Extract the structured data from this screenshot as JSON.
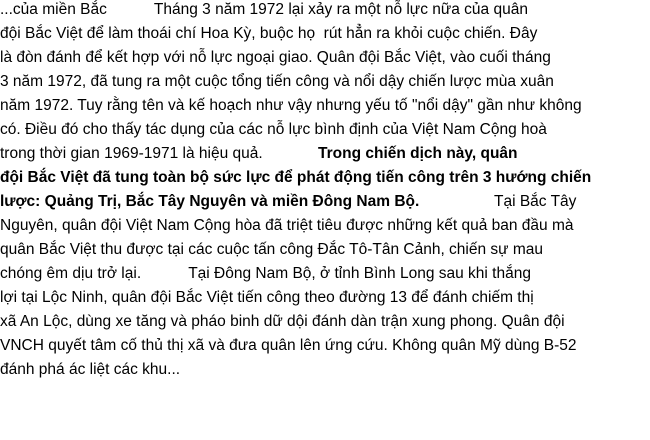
{
  "document": {
    "lines": [
      "...của miền Bắc           Tháng 3 năm 1972 lại xảy ra một nỗ lực nữa của quân",
      "đội Bắc Việt để làm thoái chí Hoa Kỳ, buộc họ  rút hẳn ra khỏi cuộc chiến. Đây",
      "là đòn đánh để kết hợp với nỗ lực ngoại giao. Quân đội Bắc Việt, vào cuối tháng",
      "3 năm 1972, đã tung ra một cuộc tổng tiến công và nổi dậy chiến lược mùa xuân",
      "năm 1972. Tuy rằng tên và kế hoạch như vậy nhưng yếu tố \"nổi dậy\" gần như không",
      "có. Điều đó cho thấy tác dụng của các nỗ lực bình định của Việt Nam Cộng hoà",
      "trong thời gian 1969-1971 là hiệu quả.",
      "Trong chiến dịch này, quân",
      "đội Bắc Việt đã tung toàn bộ sức lực để phát động tiến công trên 3 hướng chiến",
      "lược: Quảng Trị, Bắc Tây Nguyên và miền Đông Nam Bộ.",
      "Tại Bắc Tây",
      "Nguyên, quân đội Việt Nam Cộng hòa đã triệt tiêu được những kết quả ban đầu mà",
      "quân Bắc Việt thu được tại các cuộc tấn công Đắc Tô-Tân Cảnh, chiến sự mau",
      "chóng êm dịu trở lại.           Tại Đông Nam Bộ, ở tỉnh Bình Long sau khi thắng",
      "lợi tại Lộc Ninh, quân đội Bắc Việt tiến công theo đường 13 để đánh chiếm thị",
      "xã An Lộc, dùng xe tăng và pháo binh dữ dội đánh dàn trận xung phong. Quân đội",
      "VNCH quyết tâm cố thủ thị xã và đưa quân lên ứng cứu. Không quân Mỹ dùng B-52",
      "đánh phá ác liệt các khu..."
    ]
  }
}
